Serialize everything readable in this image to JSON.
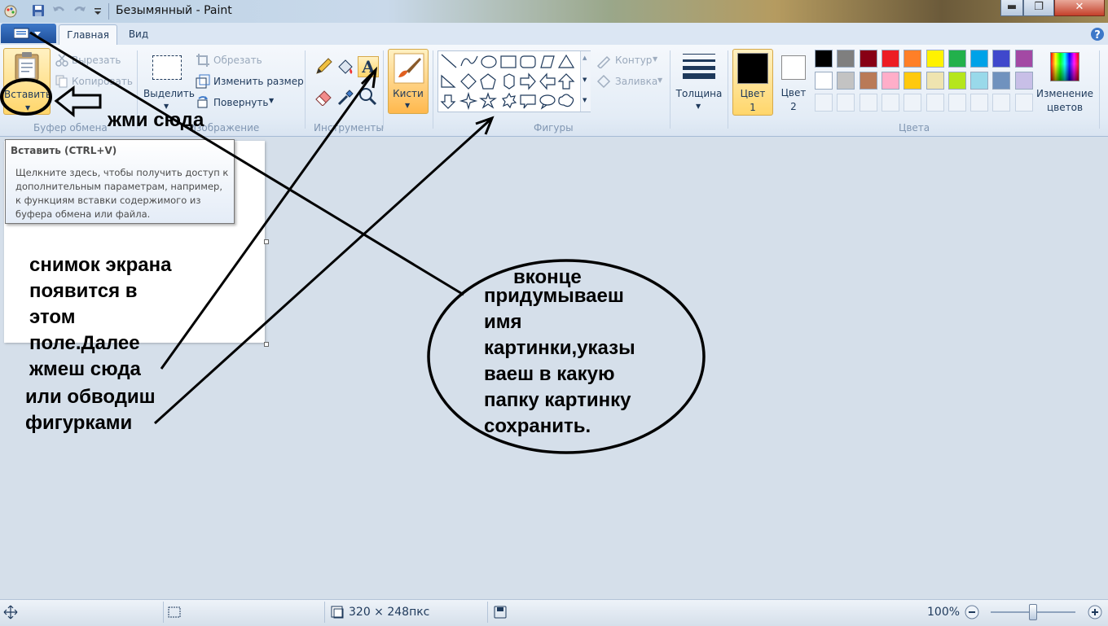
{
  "window": {
    "title": "Безымянный - Paint",
    "controls": {
      "minimize": "▬",
      "restore": "❐",
      "close": "✕"
    }
  },
  "ribbon": {
    "tabs": [
      {
        "label": "Главная"
      },
      {
        "label": "Вид"
      }
    ],
    "clipboard": {
      "paste_label": "Вставить",
      "cut_label": "Вырезать",
      "copy_label": "Копировать",
      "group_label": "Буфер обмена"
    },
    "image": {
      "select_label": "Выделить",
      "crop_label": "Обрезать",
      "resize_label": "Изменить размер",
      "rotate_label": "Повернуть",
      "group_label": "Изображение"
    },
    "tools": {
      "group_label": "Инструменты"
    },
    "brushes": {
      "label": "Кисти"
    },
    "shapes": {
      "outline_label": "Контур",
      "fill_label": "Заливка",
      "group_label": "Фигуры"
    },
    "size": {
      "label": "Толщина"
    },
    "colors": {
      "color1_label": "Цвет",
      "color1_num": "1",
      "color2_label": "Цвет",
      "color2_num": "2",
      "edit_label_1": "Изменение",
      "edit_label_2": "цветов",
      "group_label": "Цвета",
      "color1": "#000000",
      "color2": "#ffffff",
      "palette_row1": [
        "#000000",
        "#7f7f7f",
        "#880015",
        "#ed1c24",
        "#ff7f27",
        "#fff200",
        "#22b14c",
        "#00a2e8",
        "#3f48cc",
        "#a349a4"
      ],
      "palette_row2": [
        "#ffffff",
        "#c3c3c3",
        "#b97a57",
        "#ffaec9",
        "#ffc90e",
        "#efe4b0",
        "#b5e61d",
        "#99d9ea",
        "#7092be",
        "#c8bfe7"
      ]
    }
  },
  "tooltip": {
    "title": "Вставить (CTRL+V)",
    "body": "Щелкните здесь, чтобы получить доступ к дополнительным параметрам, например, к функциям вставки содержимого из буфера обмена или файла."
  },
  "statusbar": {
    "dimensions": "320 × 248пкс",
    "zoom": "100%"
  },
  "annotations": {
    "click_here": "жми сюда",
    "canvas_note": [
      "снимок экрана",
      "появится в",
      "этом",
      "поле.Далее",
      "жмеш сюда"
    ],
    "shapes_note": [
      "или обводиш",
      "фигурками"
    ],
    "end_title": "вконце",
    "end_note": [
      "придумываеш",
      "имя",
      "картинки,указы",
      "ваеш в какую",
      "папку картинку",
      "сохранить."
    ]
  }
}
